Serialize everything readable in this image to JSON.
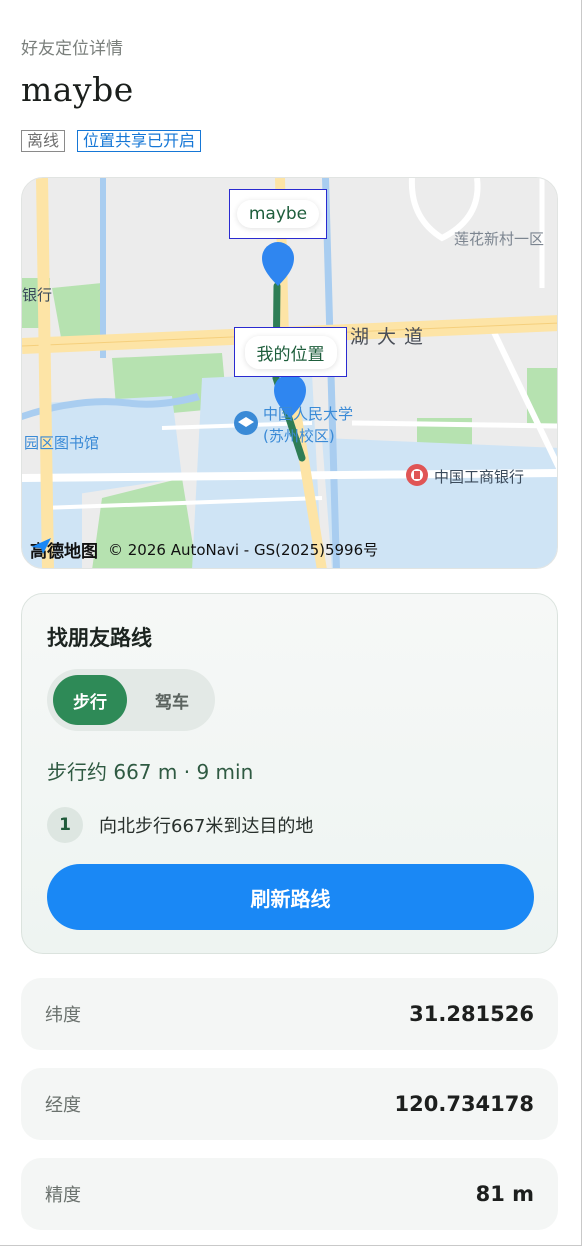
{
  "header": {
    "subtitle": "好友定位详情",
    "friend_name": "maybe",
    "badges": {
      "status": "离线",
      "sharing": "位置共享已开启"
    }
  },
  "map": {
    "friend_marker_label": "maybe",
    "my_marker_label": "我的位置",
    "places": {
      "lianhua": "莲花新村一区",
      "bank_left": "银行",
      "road": "湖大道",
      "library": "园区图书馆",
      "university_line1": "中国人民大学",
      "university_line2": "(苏州校区)",
      "icbc": "中国工商银行"
    },
    "brand": "高德地图",
    "copyright": "© 2026 AutoNavi - GS(2025)5996号",
    "colors": {
      "route": "#2e7d55",
      "marker": "#2f86f0",
      "water": "#cfe4f5",
      "green": "#b6e2b0",
      "road_major": "#fde4a6"
    }
  },
  "route": {
    "title": "找朋友路线",
    "modes": {
      "walk": "步行",
      "drive": "驾车",
      "selected": "步行"
    },
    "summary": "步行约 667 m · 9 min",
    "steps": [
      {
        "num": "1",
        "text": "向北步行667米到达目的地"
      }
    ],
    "refresh_label": "刷新路线"
  },
  "info": [
    {
      "label": "纬度",
      "value": "31.281526"
    },
    {
      "label": "经度",
      "value": "120.734178"
    },
    {
      "label": "精度",
      "value": "81 m"
    }
  ],
  "colors": {
    "accent_green": "#2e8a57",
    "accent_blue": "#1a88f5",
    "badge_blue": "#1677d6"
  }
}
